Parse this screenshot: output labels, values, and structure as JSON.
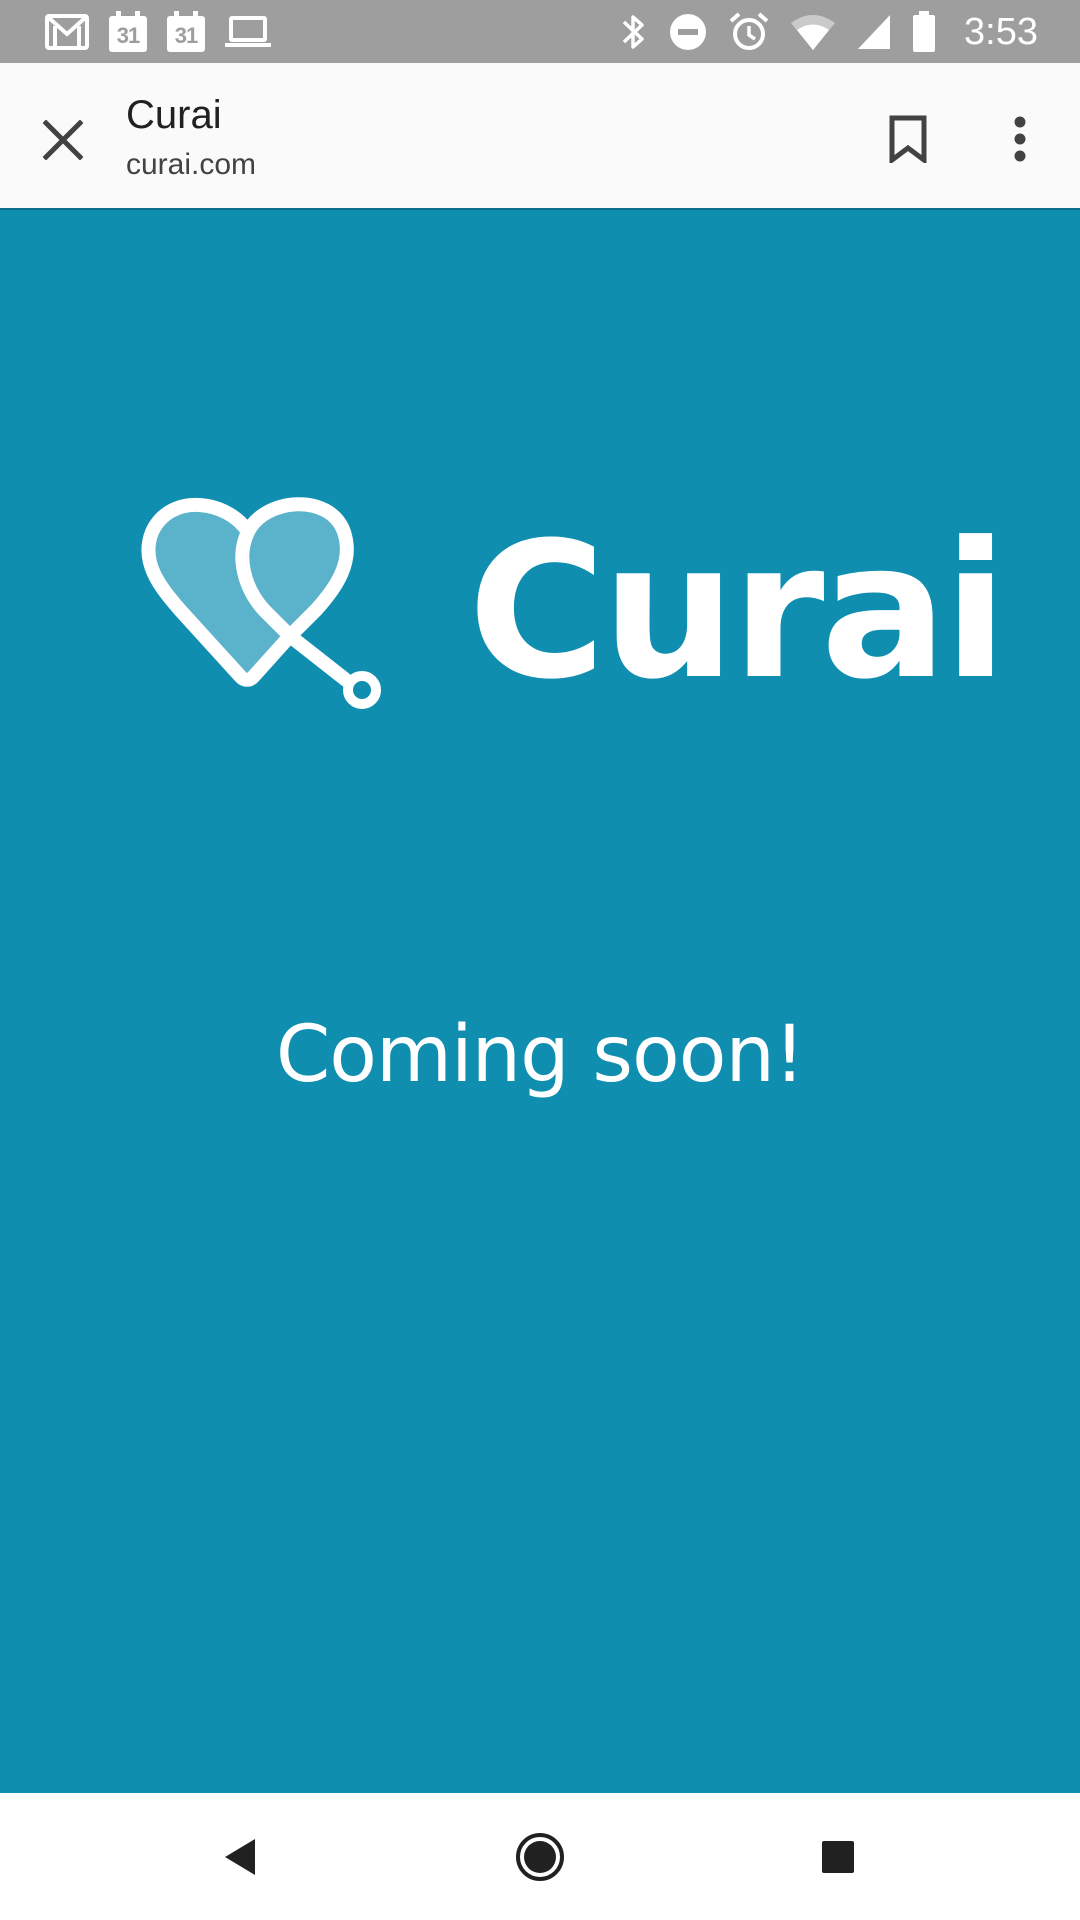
{
  "status_bar": {
    "left_icons": [
      "gmail-icon",
      "calendar-icon",
      "calendar-icon",
      "laptop-icon"
    ],
    "calendar_day": "31",
    "right_icons": [
      "bluetooth-icon",
      "do-not-disturb-icon",
      "alarm-icon",
      "wifi-icon",
      "cellular-signal-icon",
      "battery-icon"
    ],
    "time": "3:53"
  },
  "toolbar": {
    "title": "Curai",
    "url": "curai.com",
    "close_icon": "close-icon",
    "bookmark_icon": "bookmark-icon",
    "menu_icon": "more-vert-icon"
  },
  "content": {
    "logo_text": "Curai",
    "message": "Coming soon!",
    "colors": {
      "background": "#0f8eb0",
      "logo_heart_fill": "#5bb2cb",
      "text": "#ffffff"
    }
  },
  "nav_bar": {
    "buttons": [
      "back-icon",
      "home-icon",
      "recents-icon"
    ]
  },
  "colors": {
    "status_bar": "#9e9e9e",
    "toolbar": "#fafafa",
    "nav_bar": "#ffffff"
  }
}
